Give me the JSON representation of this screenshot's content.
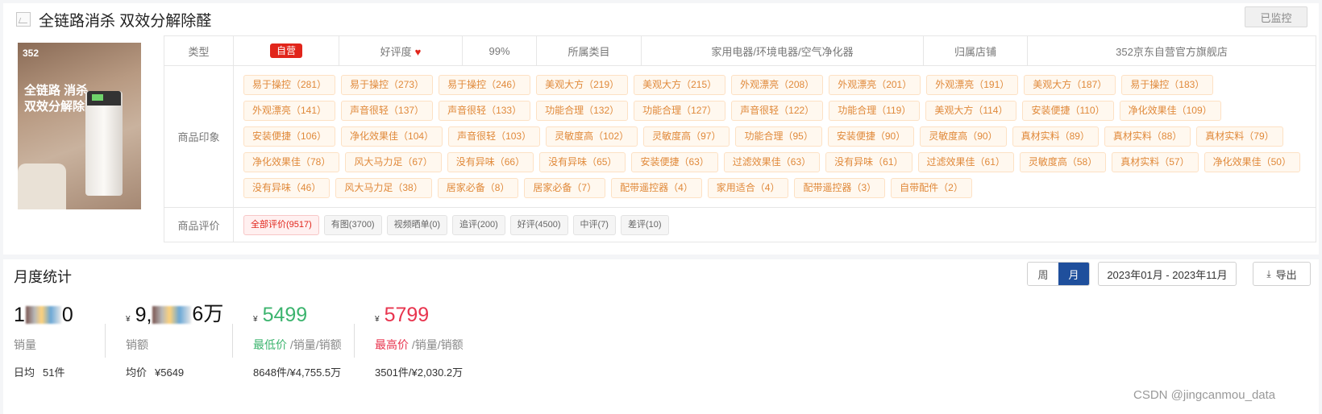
{
  "product": {
    "title": "全链路消杀 双效分解除醛",
    "monitor_label": "已监控",
    "image": {
      "brand": "352",
      "slogan_line1": "全链路 消杀",
      "slogan_line2": "双效分解除醛"
    }
  },
  "info_row": {
    "type_label": "类型",
    "type_value": "自营",
    "rating_label": "好评度",
    "rating_value": "99%",
    "category_label": "所属类目",
    "category_value": "家用电器/环境电器/空气净化器",
    "shop_label": "归属店铺",
    "shop_value": "352京东自营官方旗舰店"
  },
  "impressions": {
    "label": "商品印象",
    "tags": [
      "易于操控（281）",
      "易于操控（273）",
      "易于操控（246）",
      "美观大方（219）",
      "美观大方（215）",
      "外观漂亮（208）",
      "外观漂亮（201）",
      "外观漂亮（191）",
      "美观大方（187）",
      "易于操控（183）",
      "外观漂亮（141）",
      "声音很轻（137）",
      "声音很轻（133）",
      "功能合理（132）",
      "功能合理（127）",
      "声音很轻（122）",
      "功能合理（119）",
      "美观大方（114）",
      "安装便捷（110）",
      "净化效果佳（109）",
      "安装便捷（106）",
      "净化效果佳（104）",
      "声音很轻（103）",
      "灵敏度高（102）",
      "灵敏度高（97）",
      "功能合理（95）",
      "安装便捷（90）",
      "灵敏度高（90）",
      "真材实料（89）",
      "真材实料（88）",
      "真材实料（79）",
      "净化效果佳（78）",
      "风大马力足（67）",
      "没有异味（66）",
      "没有异味（65）",
      "安装便捷（63）",
      "过滤效果佳（63）",
      "没有异味（61）",
      "过滤效果佳（61）",
      "灵敏度高（58）",
      "真材实料（57）",
      "净化效果佳（50）",
      "没有异味（46）",
      "风大马力足（38）",
      "居家必备（8）",
      "居家必备（7）",
      "配带遥控器（4）",
      "家用适合（4）",
      "配带遥控器（3）",
      "自带配件（2）"
    ]
  },
  "reviews": {
    "label": "商品评价",
    "items": [
      "全部评价(9517)",
      "有图(3700)",
      "视频晒单(0)",
      "追评(200)",
      "好评(4500)",
      "中评(7)",
      "差评(10)"
    ]
  },
  "monthly": {
    "title": "月度统计",
    "period_week": "周",
    "period_month": "月",
    "date_range": "2023年01月 - 2023年11月",
    "export_label": "导出",
    "currency": "¥",
    "sales_volume": {
      "prefix": "1",
      "suffix": "0",
      "label": "销量",
      "daily_label": "日均",
      "daily_value": "51件"
    },
    "sales_amount": {
      "prefix": "9,",
      "suffix": "6万",
      "label": "销额",
      "avg_label": "均价",
      "avg_value": "¥5649"
    },
    "min_price": {
      "value": "5499",
      "label_hl": "最低价",
      "label_rest": " /销量/销额",
      "detail": "8648件/¥4,755.5万"
    },
    "max_price": {
      "value": "5799",
      "label_hl": "最高价",
      "label_rest": " /销量/销额",
      "detail": "3501件/¥2,030.2万"
    }
  },
  "watermark": "CSDN @jingcanmou_data",
  "colors": {
    "accent_blue": "#1f4f9c",
    "self_red": "#e1251b",
    "tag_orange": "#e0893a",
    "min_green": "#3cb46e",
    "max_red": "#e8344e"
  }
}
